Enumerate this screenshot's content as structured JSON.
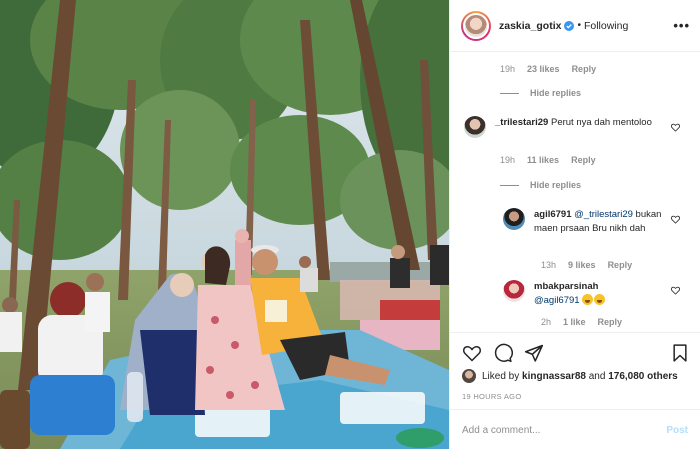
{
  "header": {
    "username": "zaskia_gotix",
    "separator": "•",
    "follow_status": "Following",
    "more_label": "•••"
  },
  "thread": [
    {
      "kind": "meta",
      "time": "19h",
      "likes": "23 likes",
      "reply": "Reply"
    },
    {
      "kind": "hide",
      "label": "Hide replies"
    },
    {
      "kind": "comment",
      "username": "_trilestari29",
      "text": "Perut nya dah mentoloo",
      "time": "19h",
      "likes": "11 likes",
      "reply": "Reply"
    },
    {
      "kind": "hide",
      "label": "Hide replies"
    },
    {
      "kind": "comment",
      "username": "agil6791",
      "mention": "@_trilestari29",
      "text": "bukan maen prsaan Bru nikh dah",
      "time": "13h",
      "likes": "9 likes",
      "reply": "Reply"
    },
    {
      "kind": "comment",
      "username": "mbakparsinah",
      "mention": "@agil6791",
      "emoji": [
        "grinning-sweat-emoji",
        "grinning-sweat-emoji"
      ],
      "time": "2h",
      "likes": "1 like",
      "reply": "Reply"
    }
  ],
  "actions": {
    "icons": [
      "heart-icon",
      "comment-icon",
      "share-icon",
      "bookmark-icon"
    ],
    "liked_prefix": "Liked by",
    "liked_user": "kingnassar88",
    "liked_and": "and",
    "liked_others": "176,080 others",
    "posted_time": "19 HOURS AGO"
  },
  "comment_box": {
    "placeholder": "Add a comment...",
    "post_label": "Post"
  },
  "colors": {
    "verified_blue": "#3897f0",
    "mention_blue": "#00376b",
    "muted_gray": "#8e8e8e",
    "post_disabled": "#b2dffc"
  }
}
